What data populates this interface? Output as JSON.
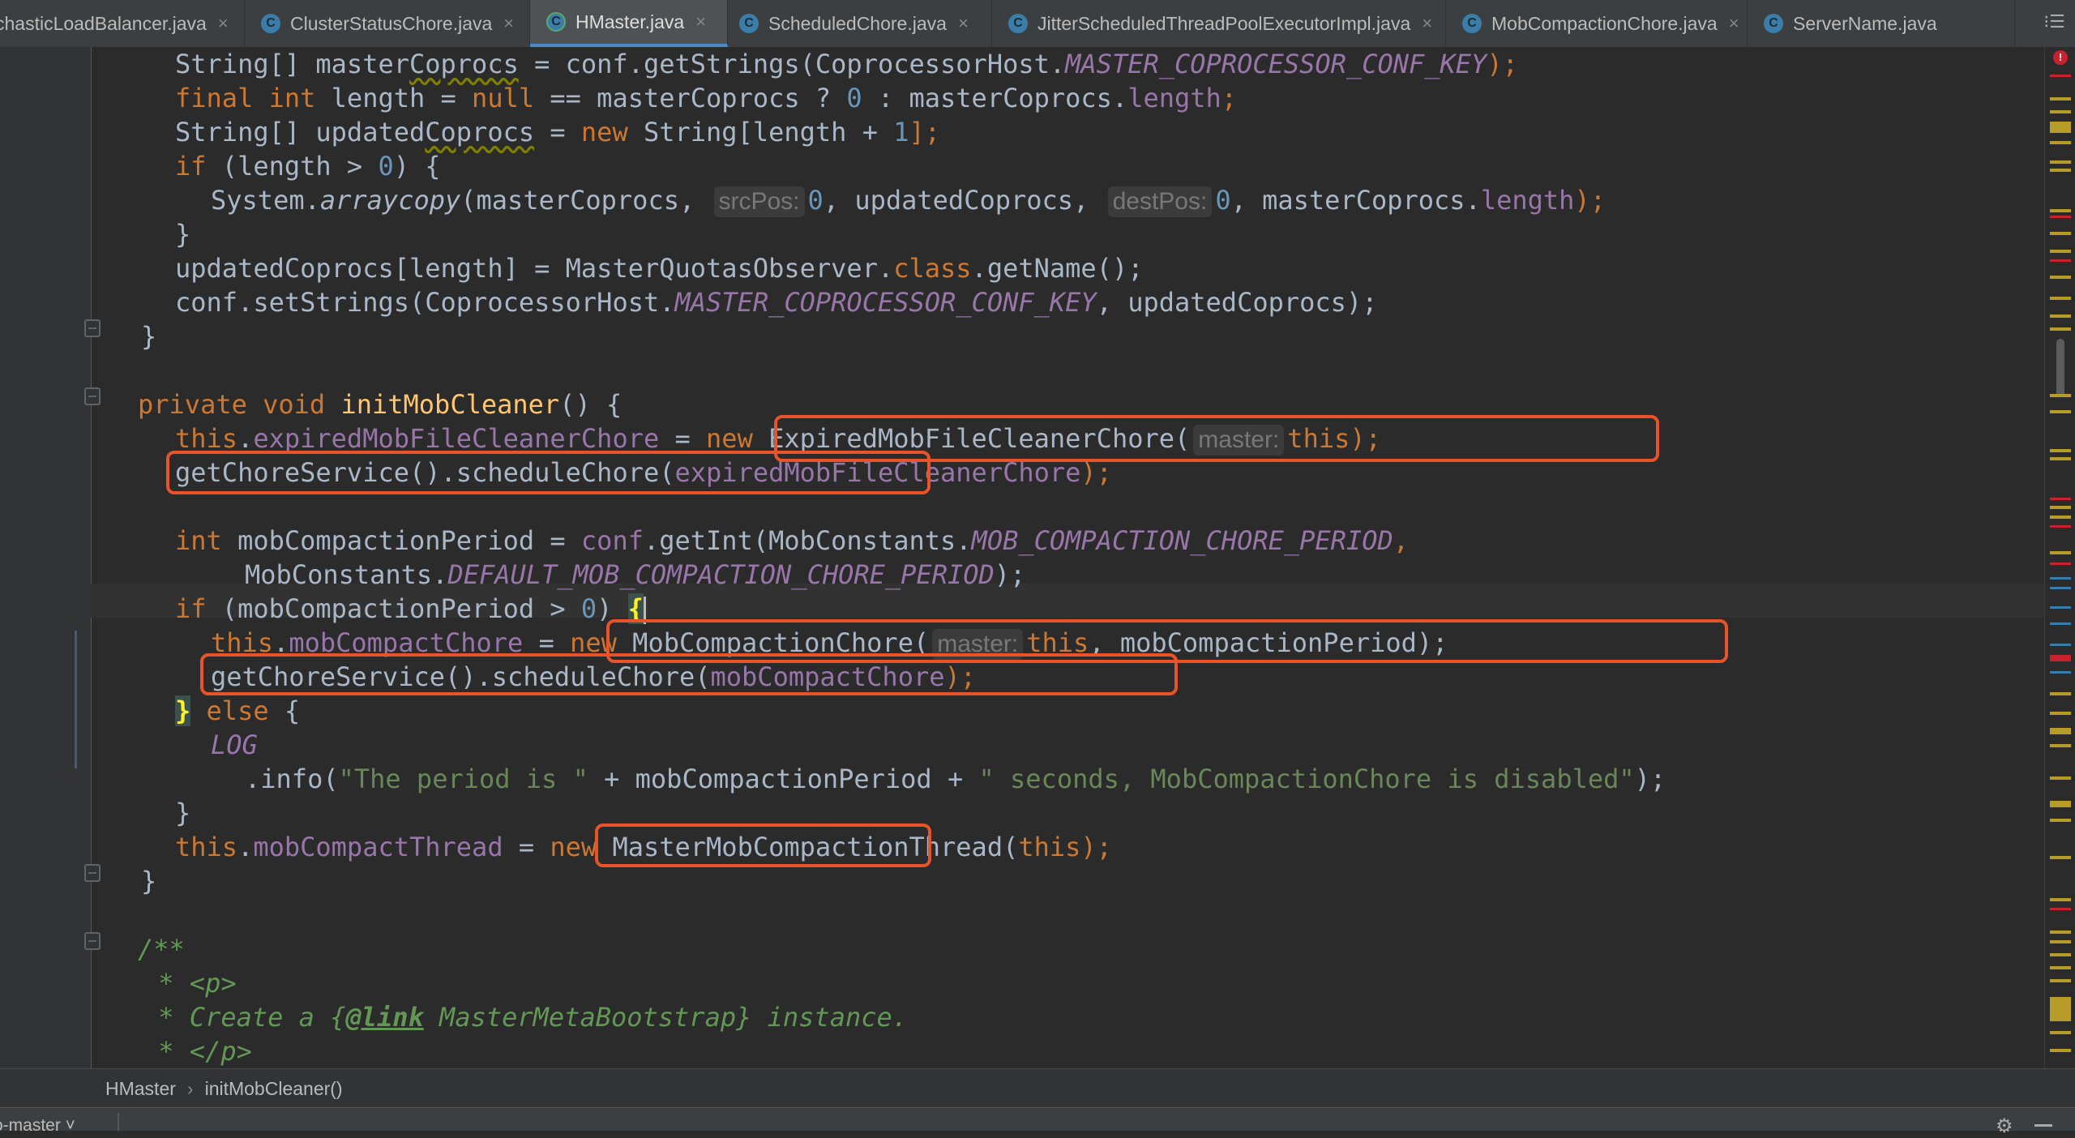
{
  "tabs": [
    {
      "label": "chasticLoadBalancer.java",
      "icon": "class-icon",
      "active": false
    },
    {
      "label": "ClusterStatusChore.java",
      "icon": "class-icon",
      "active": false
    },
    {
      "label": "HMaster.java",
      "icon": "class-icon",
      "active": true
    },
    {
      "label": "ScheduledChore.java",
      "icon": "class-icon",
      "active": false
    },
    {
      "label": "JitterScheduledThreadPoolExecutorImpl.java",
      "icon": "class-icon",
      "active": false
    },
    {
      "label": "MobCompactionChore.java",
      "icon": "class-icon",
      "active": false
    },
    {
      "label": "ServerName.java",
      "icon": "class-icon",
      "active": false
    }
  ],
  "tab_close_glyph": "×",
  "tab_overflow_label": "⁝☰",
  "code": {
    "l1": {
      "a": "String[] master",
      "b": "Coprocs",
      "c": " = conf.getStrings(CoprocessorHost.",
      "d": "MASTER_COPROCESSOR_CONF_KEY",
      "e": ");"
    },
    "l2": {
      "a": "final int",
      "b": " length = ",
      "c": "null",
      "d": " == masterCoprocs ? ",
      "e": "0",
      "f": " : masterCoprocs.",
      "g": "length",
      "h": ";"
    },
    "l3": {
      "a": "String[] updated",
      "b": "Coprocs",
      "c": " = ",
      "d": "new",
      "e": " String[length + ",
      "f": "1",
      "g": "];"
    },
    "l4": {
      "a": "if",
      "b": " (length > ",
      "c": "0",
      "d": ") {"
    },
    "l5": {
      "a": "System.",
      "b": "arraycopy",
      "c": "(masterCoprocs, ",
      "hint1": "srcPos:",
      "d": "0",
      "e": ", updatedCoprocs, ",
      "hint2": "destPos:",
      "f": "0",
      "g": ", masterCoprocs.",
      "h": "length",
      "i": ");"
    },
    "l6": "}",
    "l7": {
      "a": "updatedCoprocs[length] = MasterQuotasObserver.",
      "b": "class",
      "c": ".getName();"
    },
    "l8": {
      "a": "conf.setStrings(CoprocessorHost.",
      "b": "MASTER_COPROCESSOR_CONF_KEY",
      "c": ", updatedCoprocs);"
    },
    "l9": "}",
    "l11": {
      "a": "private void",
      "b": " ",
      "c": "initMobCleaner",
      "d": "() {"
    },
    "l12": {
      "a": "this",
      "b": ".",
      "c": "expiredMobFileCleanerChore",
      "d": " = ",
      "e": "new",
      "f": " ExpiredMobFileCleanerChore(",
      "hint": "master:",
      "g": "this",
      "h": ");"
    },
    "l13": {
      "a": "getChoreService().scheduleChore(",
      "b": "expiredMobFileCleanerChore",
      "c": ");"
    },
    "l15": {
      "a": "int",
      "b": " mobCompactionPeriod = ",
      "c": "conf",
      "d": ".getInt(MobConstants.",
      "e": "MOB_COMPACTION_CHORE_PERIOD",
      "f": ","
    },
    "l16": {
      "a": "MobConstants.",
      "b": "DEFAULT_MOB_COMPACTION_CHORE_PERIOD",
      "c": ");"
    },
    "l17": {
      "a": "if",
      "b": " (mobCompactionPeriod > ",
      "c": "0",
      "d": ") ",
      "e": "{"
    },
    "l18": {
      "a": "this",
      "b": ".",
      "c": "mobCompactChore",
      "d": " = ",
      "e": "new",
      "f": " MobCompactionChore(",
      "hint": "master:",
      "g": "this",
      "h": ", mobCompactionPeriod);"
    },
    "l19": {
      "a": "getChoreService().scheduleChore(",
      "b": "mobCompactChore",
      "c": ");"
    },
    "l20": {
      "a": "}",
      "b": " ",
      "c": "else",
      "d": " {"
    },
    "l21": "LOG",
    "l22": {
      "a": ".info(",
      "b": "\"The period is \"",
      "c": " + mobCompactionPeriod + ",
      "d": "\" seconds, MobCompactionChore is disabled\"",
      "e": ");"
    },
    "l23": "}",
    "l24": {
      "a": "this",
      "b": ".",
      "c": "mobCompactThread",
      "d": " = ",
      "e": "new",
      "f": " MasterMobCompactionThread(",
      "g": "this",
      "h": ");"
    },
    "l25": "}",
    "l27": "/**",
    "l28": {
      "a": " * ",
      "b": "<p>"
    },
    "l29": {
      "a": " * Create a {",
      "b": "@link",
      "c": " MasterMetaBootstrap",
      "d": "} instance."
    },
    "l30": {
      "a": " * ",
      "b": "</p>"
    },
    "l31": " *"
  },
  "breadcrumb": {
    "class_name": "HMaster",
    "separator": "›",
    "method_name": "initMobCleaner()"
  },
  "status": {
    "branch": "o-master ˅",
    "gear": "⚙"
  },
  "error_indicator": "!",
  "colors": {
    "background": "#2b2b2b",
    "keyword": "#cc7832",
    "number": "#6897bb",
    "field": "#9876aa",
    "method": "#ffc66d",
    "string": "#6a8759",
    "comment": "#629755",
    "highlight_box": "#e8532a",
    "active_tab_underline": "#4a88c7"
  }
}
